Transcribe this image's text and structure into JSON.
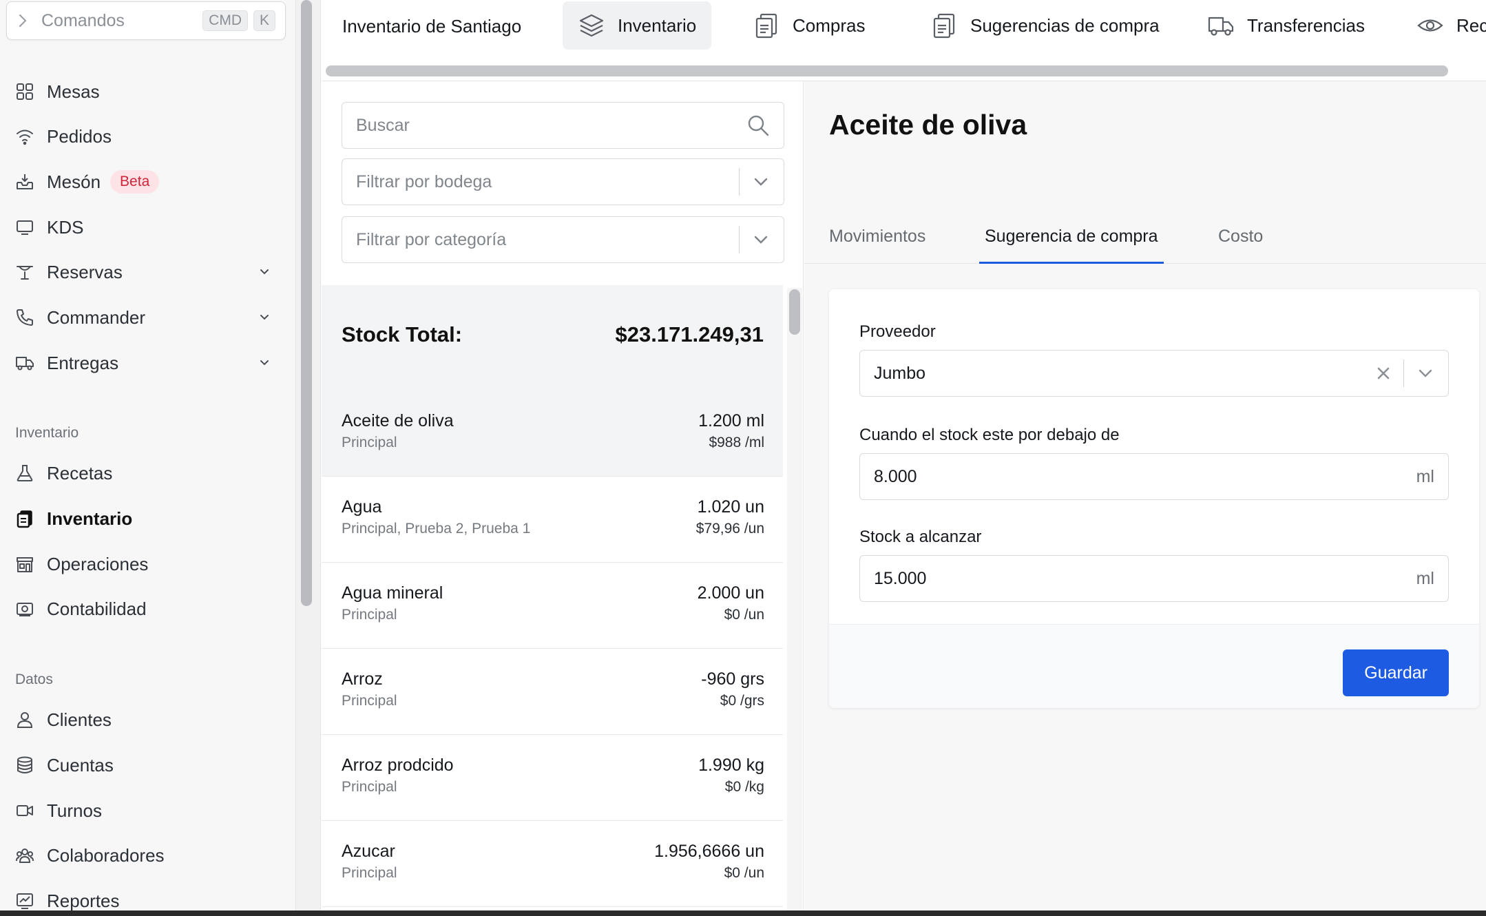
{
  "command_bar": {
    "label": "Comandos",
    "keys": [
      "CMD",
      "K"
    ]
  },
  "sidebar": {
    "items": [
      {
        "label": "Mesas",
        "icon": "grid-icon"
      },
      {
        "label": "Pedidos",
        "icon": "wifi-icon"
      },
      {
        "label": "Mesón",
        "icon": "inbox-icon",
        "badge": "Beta"
      },
      {
        "label": "KDS",
        "icon": "monitor-icon"
      },
      {
        "label": "Reservas",
        "icon": "reservation-icon",
        "expandable": true
      },
      {
        "label": "Commander",
        "icon": "phone-icon",
        "expandable": true
      },
      {
        "label": "Entregas",
        "icon": "truck-icon",
        "expandable": true
      }
    ],
    "inventory_section": {
      "label": "Inventario",
      "items": [
        {
          "label": "Recetas",
          "icon": "flask-icon"
        },
        {
          "label": "Inventario",
          "icon": "clipboard-icon",
          "active": true
        },
        {
          "label": "Operaciones",
          "icon": "store-icon"
        },
        {
          "label": "Contabilidad",
          "icon": "money-icon"
        }
      ]
    },
    "data_section": {
      "label": "Datos",
      "items": [
        {
          "label": "Clientes",
          "icon": "user-icon"
        },
        {
          "label": "Cuentas",
          "icon": "database-icon"
        },
        {
          "label": "Turnos",
          "icon": "video-icon"
        },
        {
          "label": "Colaboradores",
          "icon": "users-icon"
        },
        {
          "label": "Reportes",
          "icon": "chart-icon"
        }
      ]
    }
  },
  "topbar": {
    "title": "Inventario de Santiago",
    "tabs": [
      {
        "label": "Inventario",
        "icon": "layers-icon",
        "active": true
      },
      {
        "label": "Compras",
        "icon": "clipboard-icon"
      },
      {
        "label": "Sugerencias de compra",
        "icon": "clipboard-icon"
      },
      {
        "label": "Transferencias",
        "icon": "truck-icon"
      },
      {
        "label": "Recue",
        "icon": "eye-icon"
      }
    ]
  },
  "list": {
    "search_placeholder": "Buscar",
    "filter_warehouse_placeholder": "Filtrar por bodega",
    "filter_category_placeholder": "Filtrar por categoría",
    "stock_total_label": "Stock Total:",
    "stock_total_value": "$23.171.249,31",
    "rows": [
      {
        "name": "Aceite de oliva",
        "sub": "Principal",
        "qty": "1.200 ml",
        "price": "$988 /ml",
        "selected": true
      },
      {
        "name": "Agua",
        "sub": "Principal, Prueba 2, Prueba 1",
        "qty": "1.020 un",
        "price": "$79,96 /un"
      },
      {
        "name": "Agua mineral",
        "sub": "Principal",
        "qty": "2.000 un",
        "price": "$0 /un"
      },
      {
        "name": "Arroz",
        "sub": "Principal",
        "qty": "-960 grs",
        "price": "$0 /grs"
      },
      {
        "name": "Arroz prodcido",
        "sub": "Principal",
        "qty": "1.990 kg",
        "price": "$0 /kg"
      },
      {
        "name": "Azucar",
        "sub": "Principal",
        "qty": "1.956,6666 un",
        "price": "$0 /un"
      }
    ]
  },
  "detail": {
    "title": "Aceite de oliva",
    "tabs": [
      {
        "label": "Movimientos"
      },
      {
        "label": "Sugerencia de compra",
        "active": true
      },
      {
        "label": "Costo"
      }
    ],
    "form": {
      "supplier_label": "Proveedor",
      "supplier_value": "Jumbo",
      "threshold_label": "Cuando el stock este por debajo de",
      "threshold_value": "8.000",
      "threshold_unit": "ml",
      "target_label": "Stock a alcanzar",
      "target_value": "15.000",
      "target_unit": "ml",
      "save_label": "Guardar"
    }
  },
  "colors": {
    "accent": "#1d5be3",
    "badge_text": "#d0243b",
    "badge_bg": "#fde3e6"
  }
}
